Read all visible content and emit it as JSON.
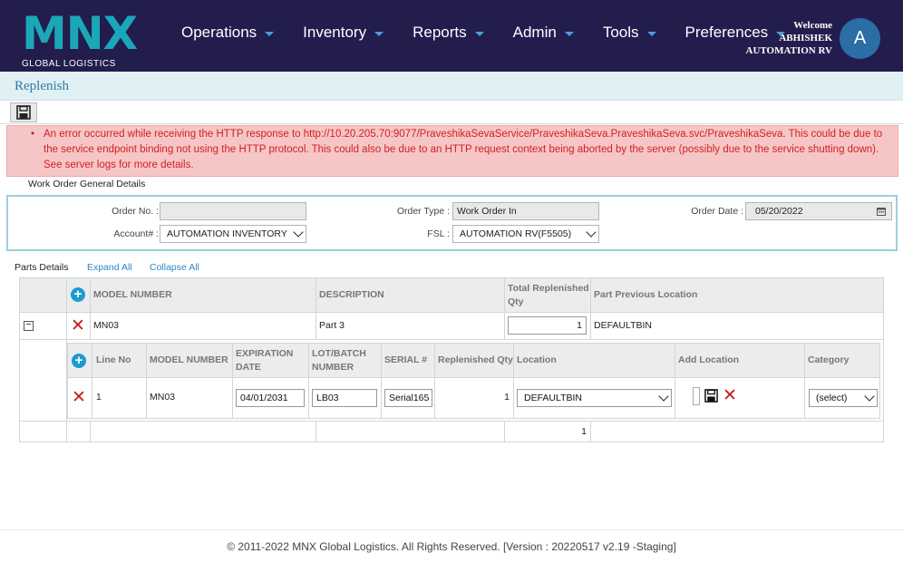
{
  "brand": {
    "logo_text": "MNX",
    "logo_subtext": "GLOBAL LOGISTICS"
  },
  "nav": [
    {
      "label": "Operations"
    },
    {
      "label": "Inventory"
    },
    {
      "label": "Reports"
    },
    {
      "label": "Admin"
    },
    {
      "label": "Tools"
    },
    {
      "label": "Preferences"
    }
  ],
  "user": {
    "welcome": "Welcome",
    "name": "ABHISHEK",
    "location": "AUTOMATION RV",
    "avatar_initial": "A"
  },
  "page": {
    "title": "Replenish"
  },
  "error": {
    "bullet": "•",
    "message": "An error occurred while receiving the HTTP response to http://10.20.205.70:9077/PraveshikaSevaService/PraveshikaSeva.PraveshikaSeva.svc/PraveshikaSeva. This could be due to the service endpoint binding not using the HTTP protocol. This could also be due to an HTTP request context being aborted by the server (possibly due to the service shutting down). See server logs for more details."
  },
  "general": {
    "section_label": "Work Order General Details",
    "order_no_label": "Order No. :",
    "order_no_value": "",
    "order_type_label": "Order Type :",
    "order_type_value": "Work Order In",
    "order_date_label": "Order Date :",
    "order_date_value": "05/20/2022",
    "account_label": "Account# :",
    "account_value": "AUTOMATION INVENTORY",
    "fsl_label": "FSL :",
    "fsl_value": "AUTOMATION RV(F5505)"
  },
  "parts": {
    "label": "Parts Details",
    "expand_all": "Expand All",
    "collapse_all": "Collapse All",
    "headers": {
      "model_number": "MODEL NUMBER",
      "description": "DESCRIPTION",
      "total_replenished_qty": "Total Replenished Qty",
      "part_previous_location": "Part Previous Location"
    },
    "row": {
      "model_number": "MN03",
      "description": "Part 3",
      "total_replenished_qty": "1",
      "part_previous_location": "DEFAULTBIN"
    },
    "sub_headers": {
      "line_no": "Line No",
      "model_number": "MODEL NUMBER",
      "expiration_date": "EXPIRATION DATE",
      "lot_batch_number": "LOT/BATCH NUMBER",
      "serial": "SERIAL #",
      "replenished_qty": "Replenished Qty",
      "location": "Location",
      "add_location": "Add Location",
      "category": "Category"
    },
    "sub_row": {
      "line_no": "1",
      "model_number": "MN03",
      "expiration_date": "04/01/2031",
      "lot_batch_number": "LB03",
      "serial": "Serial165",
      "replenished_qty": "1",
      "location": "DEFAULTBIN",
      "category": "(select)"
    },
    "total": "1"
  },
  "footer": {
    "text": "© 2011-2022 MNX Global Logistics. All Rights Reserved. [Version : 20220517 v2.19 -Staging]"
  },
  "colors": {
    "header_bg": "#231d4e",
    "brand_teal": "#1aa8b8",
    "error_bg": "#f6c6c6",
    "error_text": "#d21f1f",
    "link": "#2f86c6"
  }
}
